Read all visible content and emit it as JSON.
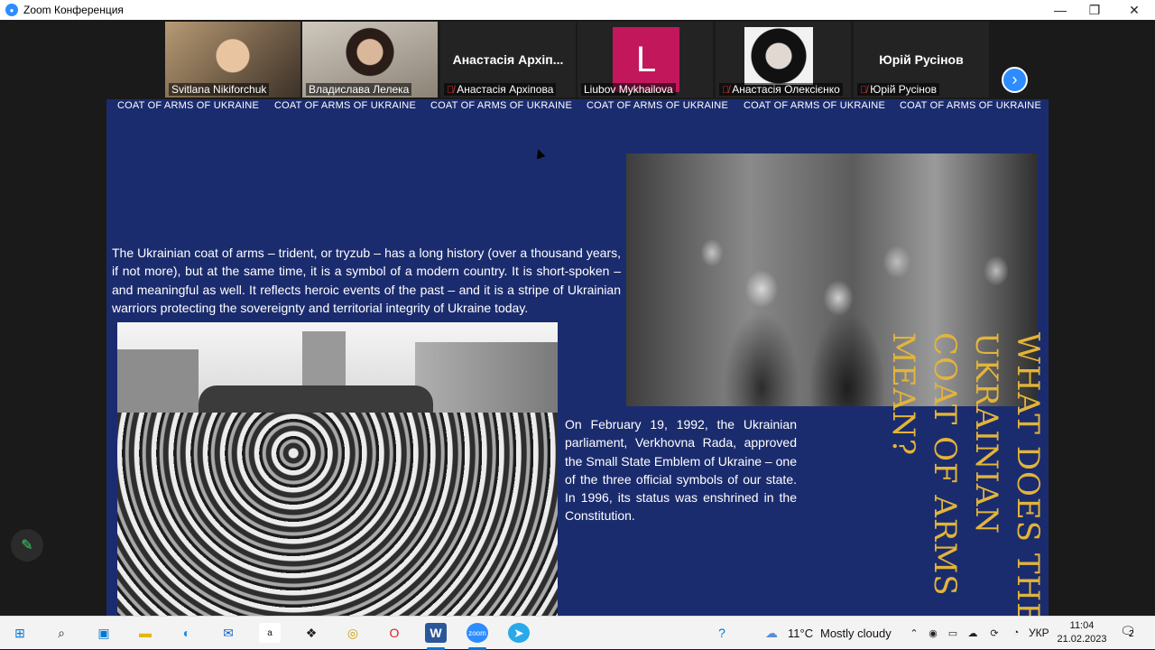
{
  "window": {
    "title": "Zoom Конференция",
    "controls": [
      "minimize",
      "maximize",
      "close"
    ]
  },
  "participants": [
    {
      "name": "Svitlana Nikiforchuk",
      "muted": false,
      "video": true
    },
    {
      "name": "Владислава Лелека",
      "muted": false,
      "video": true,
      "active_speaker": true
    },
    {
      "name": "Анастасія Архіпова",
      "display_name": "Анастасія Архіп...",
      "muted": true,
      "video": false
    },
    {
      "name": "Liubov Mykhailova",
      "avatar_letter": "L",
      "avatar_color": "#c2185b",
      "muted": false,
      "video": false
    },
    {
      "name": "Анастасія Олексієнко",
      "muted": true,
      "video": true
    },
    {
      "name": "Юрій Русінов",
      "display_name": "Юрій Русінов",
      "muted": true,
      "video": false
    }
  ],
  "slide": {
    "header_repeat": "COAT OF ARMS OF UKRAINE",
    "intro_text": "The Ukrainian coat of arms – trident, or tryzub – has a long history (over a thousand years, if not more), but at the same time, it is a symbol of a modern country. It is short-spoken – and meaningful as well. It reflects heroic events of the past – and it is a stripe of Ukrainian warriors protecting the sovereignty and territorial integrity of Ukraine today.",
    "feb_text": "On February 19, 1992, the Ukrainian parliament, Verkhovna Rada, approved the Small State Emblem of Ukraine – one of the three official symbols of our state. In 1996, its status was enshrined in the Constitution.",
    "vertical_title": "WHAT DOES THE UKRAINIAN COAT OF ARMS MEAN?",
    "background_color": "#1b2c6e",
    "title_color": "#e2b43a"
  },
  "taskbar": {
    "apps": [
      "windows-start",
      "search",
      "microsoft-store",
      "file-explorer",
      "edge",
      "mail",
      "amazon",
      "dropbox",
      "sticky-app",
      "opera",
      "word",
      "zoom",
      "telegram"
    ],
    "weather": {
      "temp": "11°C",
      "condition": "Mostly cloudy"
    },
    "language": "УКР",
    "time": "11:04",
    "date": "21.02.2023",
    "notifications": "2"
  }
}
